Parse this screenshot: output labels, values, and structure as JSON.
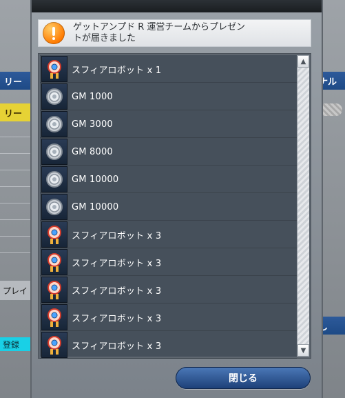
{
  "dialog": {
    "message": "ゲットアンプド R 運営チームからプレゼン\nトが届きました",
    "close_label": "閉じる",
    "icon": "warning-icon",
    "scroll_up_icon": "triangle-up-icon",
    "scroll_down_icon": "triangle-down-icon"
  },
  "gifts": [
    {
      "label": "スフィアロボット x 1",
      "icon": "sphere-robot-icon"
    },
    {
      "label": "GM 1000",
      "icon": "gm-coin-icon"
    },
    {
      "label": "GM 3000",
      "icon": "gm-coin-icon"
    },
    {
      "label": "GM 8000",
      "icon": "gm-coin-icon"
    },
    {
      "label": "GM 10000",
      "icon": "gm-coin-icon"
    },
    {
      "label": "GM 10000",
      "icon": "gm-coin-icon"
    },
    {
      "label": "スフィアロボット x 3",
      "icon": "sphere-robot-icon"
    },
    {
      "label": "スフィアロボット x 3",
      "icon": "sphere-robot-icon"
    },
    {
      "label": "スフィアロボット x 3",
      "icon": "sphere-robot-icon"
    },
    {
      "label": "スフィアロボット x 3",
      "icon": "sphere-robot-icon"
    },
    {
      "label": "スフィアロボット x 3",
      "icon": "sphere-robot-icon"
    }
  ],
  "background": {
    "left_tab_1": "リー",
    "left_tab_2": "リー",
    "left_play": "プレイ",
    "left_register": "登録",
    "right_tab": "ナル",
    "right_button": "し"
  }
}
